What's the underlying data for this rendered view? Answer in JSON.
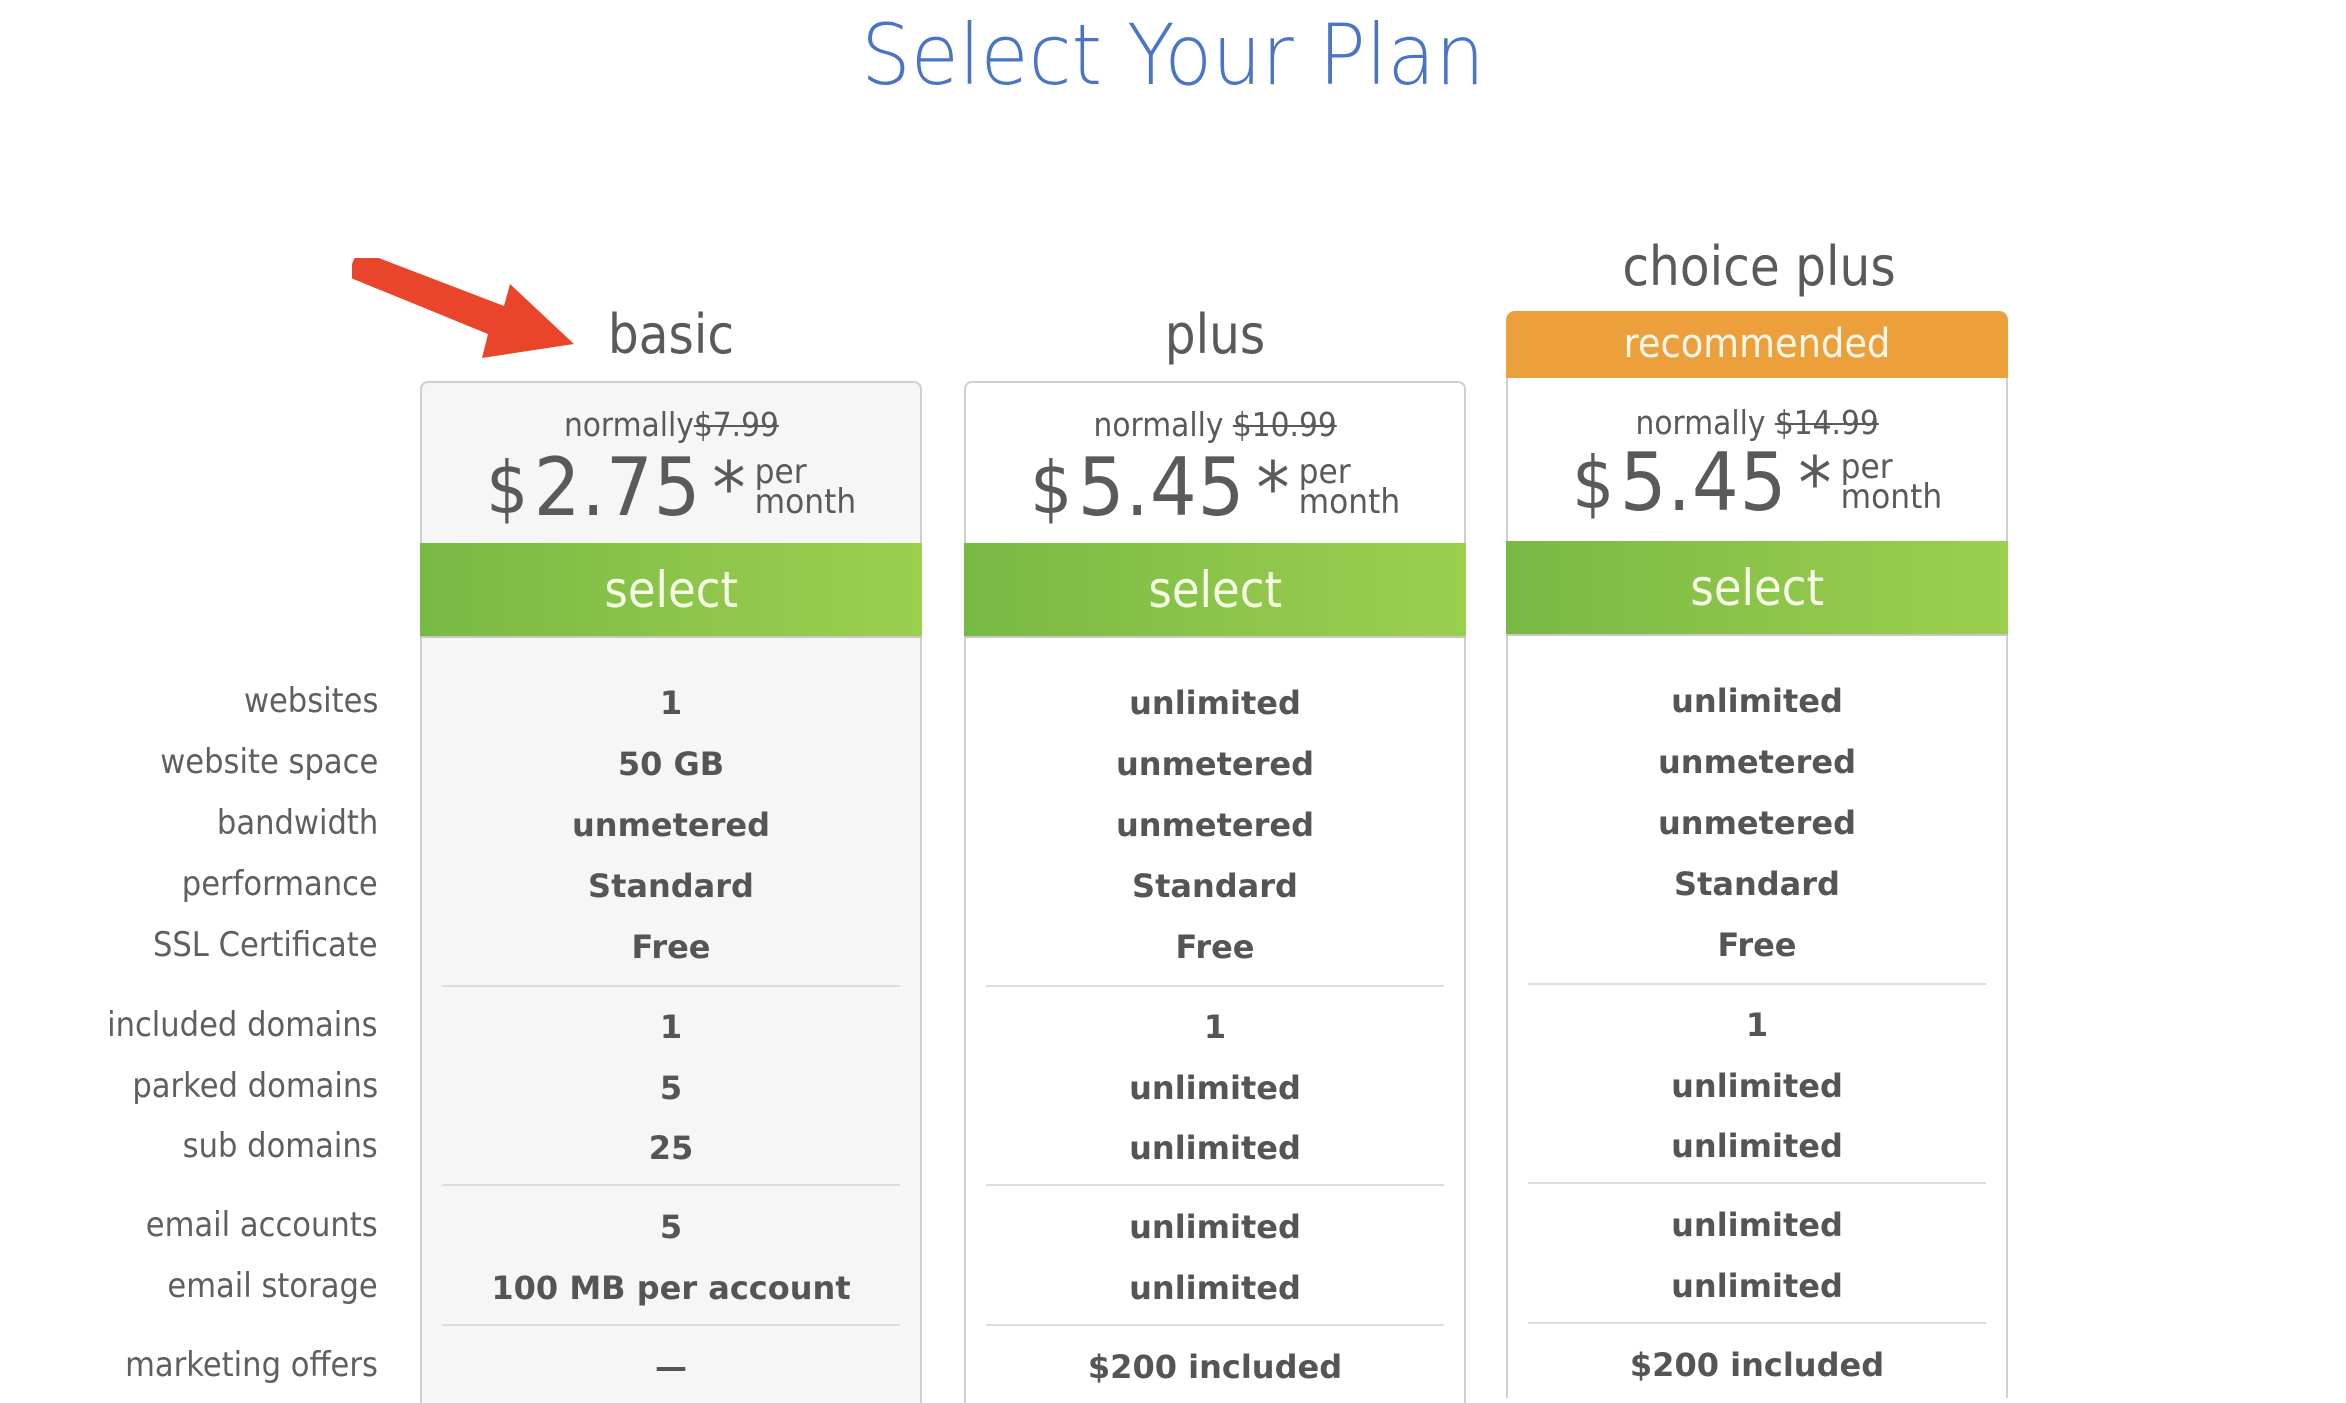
{
  "page": {
    "title": "Select Your Plan"
  },
  "annotation": {
    "arrow_color": "#e8452a",
    "arrow_points_to": "basic"
  },
  "feature_labels": [
    "websites",
    "website space",
    "bandwidth",
    "performance",
    "SSL Certificate",
    "included domains",
    "parked domains",
    "sub domains",
    "email accounts",
    "email storage",
    "marketing offers"
  ],
  "plans": [
    {
      "name": "basic",
      "badge": null,
      "normally_label": "normally",
      "normal_price": "$7.99",
      "currency": "$",
      "price": "2.75",
      "asterisk": "*",
      "per_line1": "per",
      "per_line2": "month",
      "select_label": "select",
      "features": [
        "1",
        "50 GB",
        "unmetered",
        "Standard",
        "Free",
        "1",
        "5",
        "25",
        "5",
        "100 MB per account",
        "—"
      ]
    },
    {
      "name": "plus",
      "badge": null,
      "normally_label": "normally",
      "normal_price": "$10.99",
      "currency": "$",
      "price": "5.45",
      "asterisk": "*",
      "per_line1": "per",
      "per_line2": "month",
      "select_label": "select",
      "features": [
        "unlimited",
        "unmetered",
        "unmetered",
        "Standard",
        "Free",
        "1",
        "unlimited",
        "unlimited",
        "unlimited",
        "unlimited",
        "$200 included"
      ]
    },
    {
      "name": "choice plus",
      "badge": "recommended",
      "normally_label": "normally",
      "normal_price": "$14.99",
      "currency": "$",
      "price": "5.45",
      "asterisk": "*",
      "per_line1": "per",
      "per_line2": "month",
      "select_label": "select",
      "features": [
        "unlimited",
        "unmetered",
        "unmetered",
        "Standard",
        "Free",
        "1",
        "unlimited",
        "unlimited",
        "unlimited",
        "unlimited",
        "$200 included"
      ]
    }
  ],
  "colors": {
    "title": "#4a74c6",
    "select_button_start": "#78b945",
    "select_button_end": "#9bcf4e",
    "recommended_badge": "#eba03c",
    "annotation_arrow": "#e8452a"
  }
}
